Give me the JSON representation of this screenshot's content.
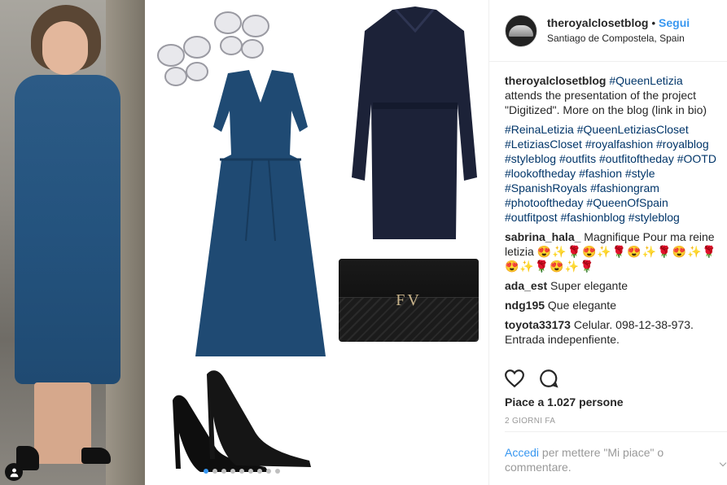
{
  "post": {
    "username": "theroyalclosetblog",
    "separator": "•",
    "follow_label": "Segui",
    "location": "Santiago de Compostela, Spain"
  },
  "media": {
    "monogram": "FV",
    "carousel_total": 9,
    "carousel_active_index": 0,
    "tag_icon": "user-tag-icon"
  },
  "caption": {
    "username": "theroyalclosetblog",
    "mention": "#QueenLetizia",
    "text": "attends the presentation of the project \"Digitized\". More on the blog (link in bio)",
    "hashtags": [
      "#ReinaLetizia",
      "#QueenLetiziasCloset",
      "#LetiziasCloset",
      "#royalfashion",
      "#royalblog",
      "#styleblog",
      "#outfits",
      "#outfitoftheday",
      "#OOTD",
      "#lookoftheday",
      "#fashion",
      "#style",
      "#SpanishRoyals",
      "#fashiongram",
      "#photooftheday",
      "#QueenOfSpain",
      "#outfitpost",
      "#fashionblog",
      "#styleblog"
    ]
  },
  "comments": [
    {
      "user": "sabrina_hala_",
      "text": "Magnifique Pour ma reine letizia",
      "emoji": "😍✨🌹😍✨🌹😍✨🌹😍✨🌹😍✨🌹😍✨🌹"
    },
    {
      "user": "ada_est",
      "text": "Super elegante"
    },
    {
      "user": "ndg195",
      "text": "Que elegante"
    },
    {
      "user": "toyota33173",
      "text": "Celular. 098-12-38-973. Entrada indepenfiente."
    }
  ],
  "actions": {
    "like_icon": "heart-icon",
    "comment_icon": "comment-bubble-icon"
  },
  "likes": "Piace a 1.027 persone",
  "time_ago": "2 GIORNI FA",
  "login_prompt": {
    "link": "Accedi",
    "text": "per mettere \"Mi piace\" o commentare."
  },
  "colors": {
    "link": "#3897f0",
    "hashtag": "#003569",
    "muted": "#999999"
  }
}
